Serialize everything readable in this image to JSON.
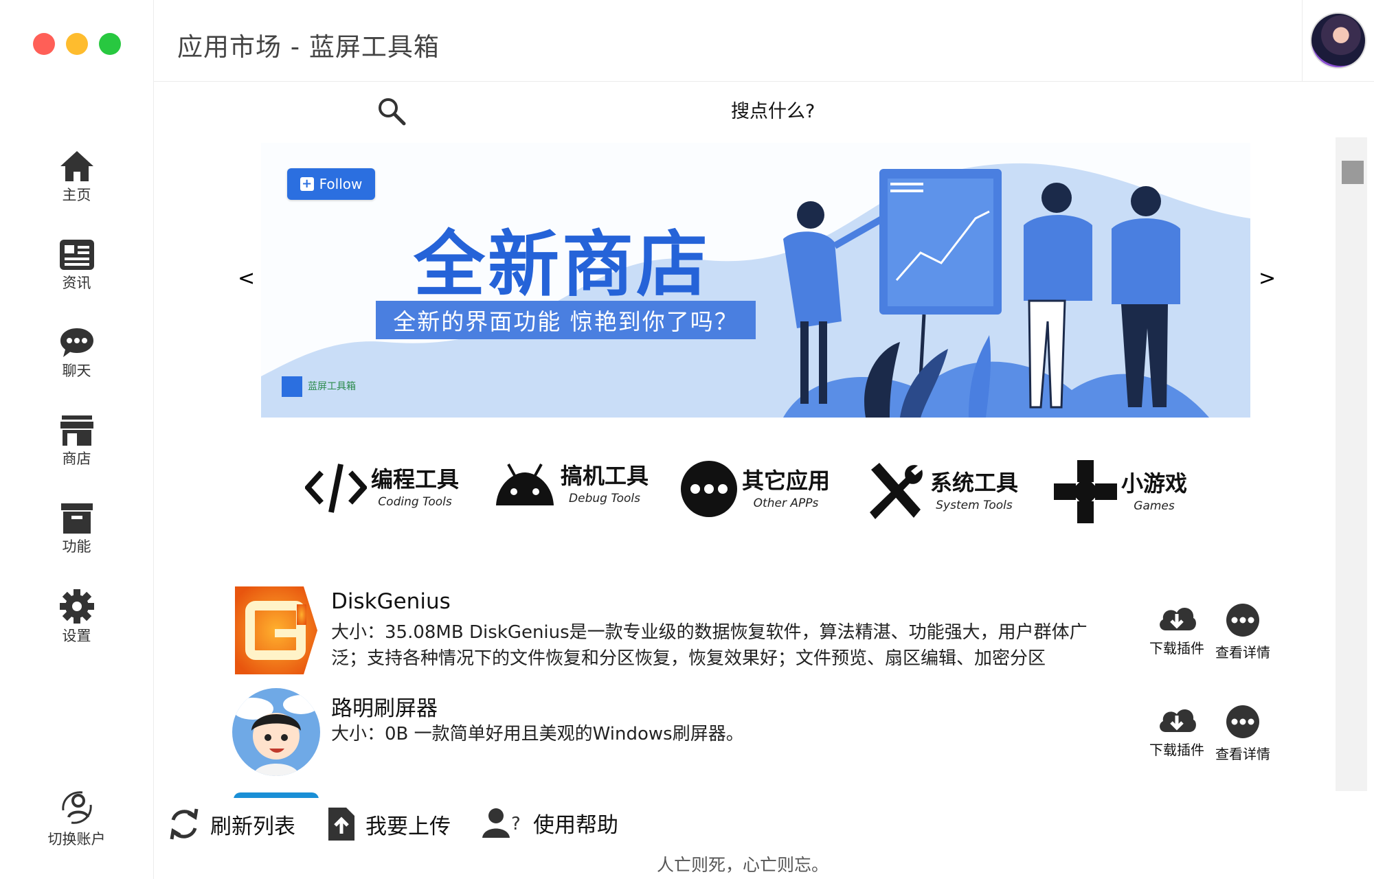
{
  "window": {
    "title": "应用市场 - 蓝屏工具箱"
  },
  "sidebar": {
    "items": [
      {
        "label": "主页",
        "icon": "home-icon"
      },
      {
        "label": "资讯",
        "icon": "news-icon"
      },
      {
        "label": "聊天",
        "icon": "chat-icon"
      },
      {
        "label": "商店",
        "icon": "store-icon"
      },
      {
        "label": "功能",
        "icon": "archive-icon"
      },
      {
        "label": "设置",
        "icon": "gear-icon"
      }
    ],
    "switch_account": "切换账户"
  },
  "search": {
    "text": "搜点什么?"
  },
  "banner": {
    "follow_label": "Follow",
    "headline": "全新商店",
    "subline": "全新的界面功能 惊艳到你了吗？",
    "logo_text": "蓝屏工具箱",
    "prev": "<",
    "next": ">"
  },
  "categories": [
    {
      "cn": "编程工具",
      "en": "Coding Tools",
      "icon": "code-icon"
    },
    {
      "cn": "搞机工具",
      "en": "Debug Tools",
      "icon": "android-icon"
    },
    {
      "cn": "其它应用",
      "en": "Other APPs",
      "icon": "more-icon"
    },
    {
      "cn": "系统工具",
      "en": "System Tools",
      "icon": "tools-icon"
    },
    {
      "cn": "小游戏",
      "en": "Games",
      "icon": "gamepad-icon"
    }
  ],
  "apps": [
    {
      "name": "DiskGenius",
      "description": "大小：35.08MB   DiskGenius是一款专业级的数据恢复软件，算法精湛、功能强大，用户群体广泛；支持各种情况下的文件恢复和分区恢复，恢复效果好；文件预览、扇区编辑、加密分区",
      "download_label": "下载插件",
      "details_label": "查看详情"
    },
    {
      "name": "路明刷屏器",
      "description": "大小：0B   一款简单好用且美观的Windows刷屏器。",
      "download_label": "下载插件",
      "details_label": "查看详情"
    }
  ],
  "bottom": {
    "refresh": "刷新列表",
    "upload": "我要上传",
    "help": "使用帮助",
    "motto": "人亡则死，心亡则忘。"
  },
  "colors": {
    "accent": "#2563d8",
    "banner_bg": "#c9ddf7"
  }
}
